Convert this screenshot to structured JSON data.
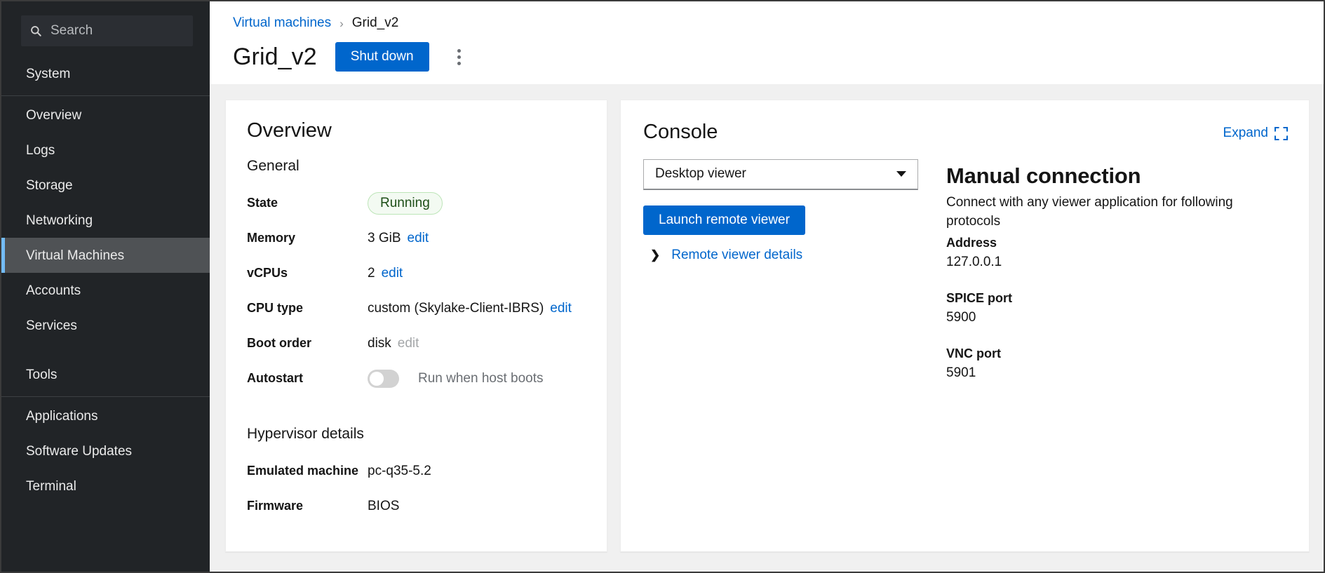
{
  "sidebar": {
    "search": {
      "placeholder": "Search",
      "value": "",
      "icon": "search-icon"
    },
    "groups": [
      {
        "header": "System",
        "items": [
          {
            "label": "Overview",
            "selected": false
          },
          {
            "label": "Logs",
            "selected": false
          },
          {
            "label": "Storage",
            "selected": false
          },
          {
            "label": "Networking",
            "selected": false
          },
          {
            "label": "Virtual Machines",
            "selected": true
          },
          {
            "label": "Accounts",
            "selected": false
          },
          {
            "label": "Services",
            "selected": false
          }
        ]
      },
      {
        "header": "Tools",
        "items": [
          {
            "label": "Applications",
            "selected": false
          },
          {
            "label": "Software Updates",
            "selected": false
          },
          {
            "label": "Terminal",
            "selected": false
          }
        ]
      }
    ]
  },
  "header": {
    "breadcrumb": {
      "parent": "Virtual machines",
      "separator": "›",
      "current": "Grid_v2"
    },
    "title": "Grid_v2",
    "shutdown_label": "Shut down",
    "kebab_name": "more-actions-icon"
  },
  "overview": {
    "card_title": "Overview",
    "general_title": "General",
    "rows": [
      {
        "label": "State",
        "value": "Running",
        "kind": "badge"
      },
      {
        "label": "Memory",
        "value": "3 GiB",
        "action": "edit",
        "action_enabled": true
      },
      {
        "label": "vCPUs",
        "value": "2",
        "action": "edit",
        "action_enabled": true
      },
      {
        "label": "CPU type",
        "value": "custom (Skylake-Client-IBRS)",
        "action": "edit",
        "action_enabled": true
      },
      {
        "label": "Boot order",
        "value": "disk",
        "action": "edit",
        "action_enabled": false
      },
      {
        "label": "Autostart",
        "value": "",
        "kind": "toggle",
        "toggle_on": false,
        "toggle_label": "Run when host boots"
      }
    ],
    "hypervisor_title": "Hypervisor details",
    "hypervisor_rows": [
      {
        "label": "Emulated machine",
        "value": "pc-q35-5.2"
      },
      {
        "label": "Firmware",
        "value": "BIOS"
      }
    ]
  },
  "console": {
    "card_title": "Console",
    "expand_label": "Expand",
    "expand_icon": "expand-icon",
    "viewer_select": {
      "value": "Desktop viewer"
    },
    "launch_label": "Launch remote viewer",
    "details_label": "Remote viewer details",
    "manual": {
      "title": "Manual connection",
      "description": "Connect with any viewer application for following protocols",
      "fields": [
        {
          "label": "Address",
          "value": "127.0.0.1"
        },
        {
          "label": "SPICE port",
          "value": "5900"
        },
        {
          "label": "VNC port",
          "value": "5901"
        }
      ]
    }
  },
  "colors": {
    "accent": "#0066cc",
    "sidebar_bg": "#212427",
    "sidebar_selected": "#4f5255",
    "selected_marker": "#73bcf7",
    "content_bg": "#f0f0f0",
    "running_bg": "#f3faf2",
    "running_border": "#bde5b8",
    "running_text": "#1e4f18"
  }
}
